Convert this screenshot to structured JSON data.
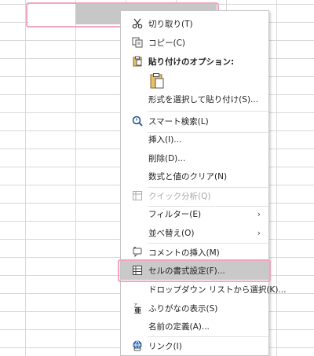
{
  "menu": {
    "cut": "切り取り(T)",
    "copy": "コピー(C)",
    "paste_options": "貼り付けのオプション:",
    "paste_special": "形式を選択して貼り付け(S)...",
    "smart_lookup": "スマート検索(L)",
    "insert": "挿入(I)...",
    "delete": "削除(D)...",
    "clear_contents": "数式と値のクリア(N)",
    "quick_analysis": "クイック分析(Q)",
    "filter": "フィルター(E)",
    "sort": "並べ替え(O)",
    "insert_comment": "コメントの挿入(M)",
    "format_cells": "セルの書式設定(F)...",
    "pick_from_list": "ドロップダウン リストから選択(K)...",
    "phonetic": "ふりがなの表示(S)",
    "define_name": "名前の定義(A)...",
    "link": "リンク(I)",
    "submenu_arrow": "›"
  },
  "icons": {
    "cut": "scissors-icon",
    "copy": "copy-icon",
    "paste": "clipboard-icon",
    "smart_lookup": "search-icon",
    "quick_analysis": "quick-analysis-icon",
    "insert_comment": "comment-icon",
    "format_cells": "format-cells-icon",
    "phonetic": "phonetic-icon",
    "link": "link-icon"
  },
  "colors": {
    "highlight": "#f0a6c0",
    "hover": "#c9c9c9",
    "disabled": "#a8a8a8"
  }
}
